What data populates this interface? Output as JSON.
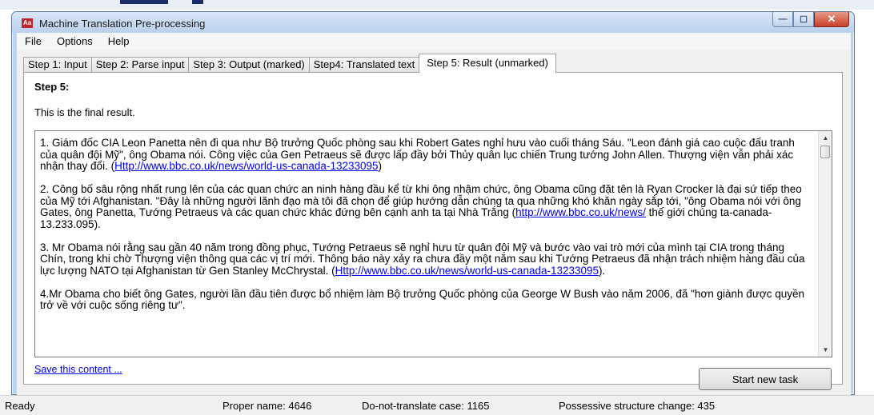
{
  "window": {
    "title": "Machine Translation Pre-processing",
    "icon_text": "Aa"
  },
  "title_buttons": {
    "minimize": "—",
    "maximize": "☐",
    "close": "✕"
  },
  "menu": [
    "File",
    "Options",
    "Help"
  ],
  "tabs": [
    {
      "label": "Step 1: Input",
      "active": false
    },
    {
      "label": "Step 2: Parse input",
      "active": false
    },
    {
      "label": "Step 3: Output (marked)",
      "active": false
    },
    {
      "label": "Step4: Translated text",
      "active": false
    },
    {
      "label": "Step 5: Result (unmarked)",
      "active": true
    }
  ],
  "panel": {
    "heading": "Step 5:",
    "description": "This is the final result.",
    "result_paragraphs": [
      {
        "text": "1. Giám đốc CIA Leon Panetta nên đi qua như Bộ trưởng Quốc phòng sau khi Robert Gates nghỉ hưu vào cuối tháng Sáu. \"Leon đánh giá cao cuộc đấu tranh của quân đội Mỹ\", ông Obama nói. Công việc của Gen Petraeus sẽ được lấp đầy bởi Thủy quân lục chiến Trung tướng John Allen. Thượng viện vẫn phải xác nhận thay đổi. (",
        "link": "Http://www.bbc.co.uk/news/world-us-canada-13233095",
        "after": ")"
      },
      {
        "text": "2. Công bố sâu rộng nhất rung lên của các quan chức an ninh hàng đầu kể từ khi ông nhậm chức, ông Obama cũng đặt tên là Ryan Crocker là đại sứ tiếp theo của Mỹ tới Afghanistan. \"Đây là những người lãnh đạo mà tôi đã chọn để giúp hướng dẫn chúng ta qua những khó khăn ngày sắp tới, \"ông Obama nói với ông Gates, ông Panetta, Tướng Petraeus và các quan chức khác đứng bên cạnh anh ta tại Nhà Trắng (",
        "link": "http://www.bbc.co.uk/news/",
        "after": " thế giới chúng ta-canada-13.233.095)."
      },
      {
        "text": "3. Mr Obama nói rằng sau gần 40 năm trong đồng phục, Tướng Petraeus sẽ nghỉ hưu từ quân đội Mỹ và bước vào vai trò mới của mình tại CIA trong tháng Chín, trong khi chờ Thượng viện thông qua các vị trí mới. Thông báo này xảy ra chưa đầy một năm sau khi Tướng Petraeus đã nhận trách nhiệm hàng đầu của lực lượng NATO tại Afghanistan từ Gen Stanley McChrystal. (",
        "link": "Http://www.bbc.co.uk/news/world-us-canada-13233095",
        "after": ")."
      },
      {
        "text": "4.Mr Obama cho biết ông Gates, người lần đầu tiên được bổ nhiệm làm Bộ trưởng Quốc phòng của George W Bush vào năm 2006, đã \"hơn giành được quyền trở về với cuộc sống riêng tư\".",
        "link": "",
        "after": ""
      }
    ],
    "save_link": "Save this content ...",
    "start_button": "Start new task"
  },
  "status": {
    "ready": "Ready",
    "proper_name": "Proper name: 4646",
    "do_not_translate": "Do-not-translate case: 1165",
    "possessive": "Possessive structure change: 435"
  }
}
